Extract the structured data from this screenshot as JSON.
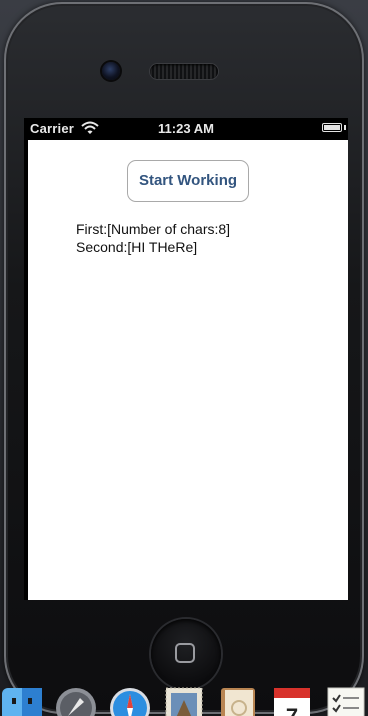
{
  "status_bar": {
    "carrier": "Carrier",
    "time": "11:23 AM",
    "wifi_icon": "wifi-icon",
    "battery_icon": "battery-icon"
  },
  "app": {
    "button_label": "Start Working",
    "output_lines": [
      "First:[Number of chars:8]",
      "Second:[HI THeRe]"
    ]
  },
  "device": {
    "home_button_icon": "home-button-icon"
  },
  "dock": {
    "icons": [
      "finder-icon",
      "launchpad-icon",
      "safari-icon",
      "mail-stamp-icon",
      "address-book-icon",
      "calendar-icon",
      "reminders-icon"
    ],
    "calendar_day": "7"
  },
  "colors": {
    "button_text": "#33557f",
    "screen_background": "#ffffff"
  }
}
